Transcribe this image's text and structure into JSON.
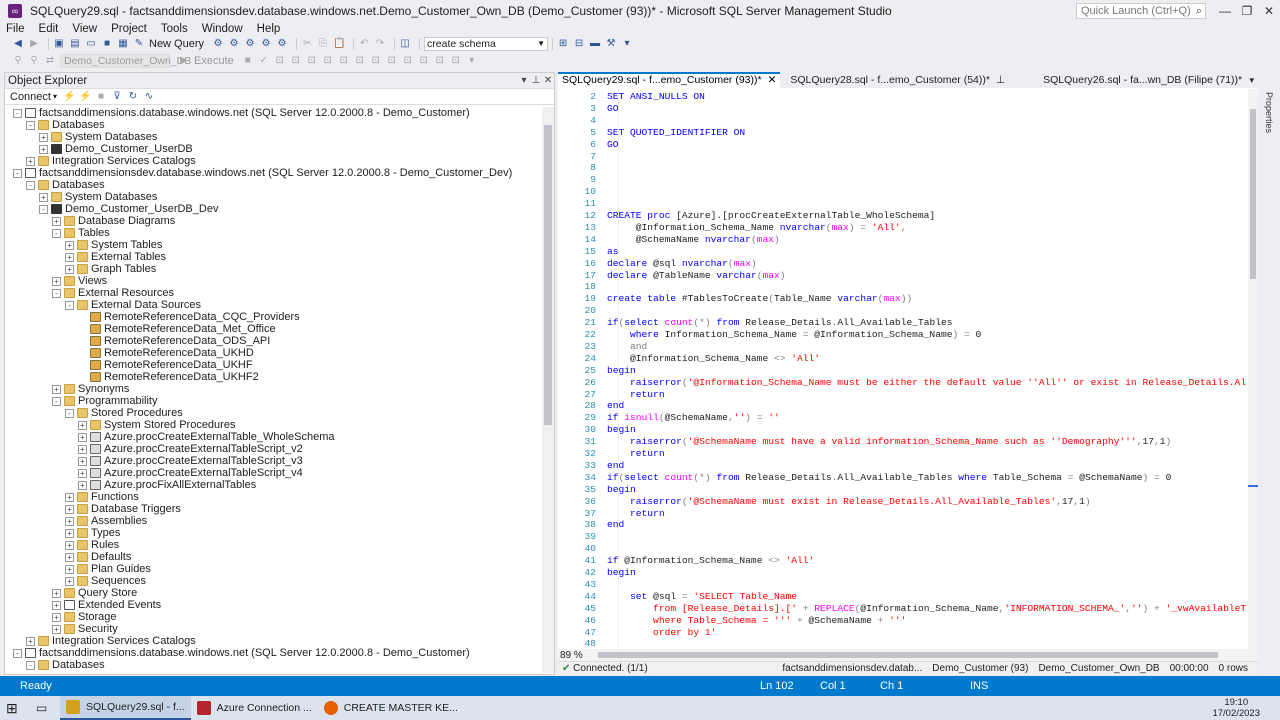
{
  "window": {
    "title": "SQLQuery29.sql - factsanddimensionsdev.database.windows.net.Demo_Customer_Own_DB (Demo_Customer (93))* - Microsoft SQL Server Management Studio",
    "quick_launch": "Quick Launch (Ctrl+Q)"
  },
  "menu": [
    "File",
    "Edit",
    "View",
    "Project",
    "Tools",
    "Window",
    "Help"
  ],
  "toolbar": {
    "new_query": "New Query",
    "search_value": "create schema",
    "database": "Demo_Customer_Own_DB",
    "execute": "Execute"
  },
  "object_explorer": {
    "title": "Object Explorer",
    "connect": "Connect",
    "tree": [
      {
        "d": 0,
        "e": "-",
        "i": "srv",
        "t": "factsanddimensions.database.windows.net (SQL Server 12.0.2000.8 - Demo_Customer)"
      },
      {
        "d": 1,
        "e": "-",
        "i": "fold",
        "t": "Databases"
      },
      {
        "d": 2,
        "e": "+",
        "i": "fold",
        "t": "System Databases"
      },
      {
        "d": 2,
        "e": "+",
        "i": "db",
        "t": "Demo_Customer_UserDB"
      },
      {
        "d": 1,
        "e": "+",
        "i": "fold",
        "t": "Integration Services Catalogs"
      },
      {
        "d": 0,
        "e": "-",
        "i": "srv",
        "t": "factsanddimensionsdev.database.windows.net (SQL Server 12.0.2000.8 - Demo_Customer_Dev)"
      },
      {
        "d": 1,
        "e": "-",
        "i": "fold",
        "t": "Databases"
      },
      {
        "d": 2,
        "e": "+",
        "i": "fold",
        "t": "System Databases"
      },
      {
        "d": 2,
        "e": "-",
        "i": "db",
        "t": "Demo_Customer_UserDB_Dev"
      },
      {
        "d": 3,
        "e": "+",
        "i": "fold",
        "t": "Database Diagrams"
      },
      {
        "d": 3,
        "e": "-",
        "i": "fold",
        "t": "Tables"
      },
      {
        "d": 4,
        "e": "+",
        "i": "fold",
        "t": "System Tables"
      },
      {
        "d": 4,
        "e": "+",
        "i": "fold",
        "t": "External Tables"
      },
      {
        "d": 4,
        "e": "+",
        "i": "fold",
        "t": "Graph Tables"
      },
      {
        "d": 3,
        "e": "+",
        "i": "fold",
        "t": "Views"
      },
      {
        "d": 3,
        "e": "-",
        "i": "fold",
        "t": "External Resources"
      },
      {
        "d": 4,
        "e": "-",
        "i": "fold",
        "t": "External Data Sources"
      },
      {
        "d": 5,
        "e": "",
        "i": "ext",
        "t": "RemoteReferenceData_CQC_Providers"
      },
      {
        "d": 5,
        "e": "",
        "i": "ext",
        "t": "RemoteReferenceData_Met_Office"
      },
      {
        "d": 5,
        "e": "",
        "i": "ext",
        "t": "RemoteReferenceData_ODS_API"
      },
      {
        "d": 5,
        "e": "",
        "i": "ext",
        "t": "RemoteReferenceData_UKHD"
      },
      {
        "d": 5,
        "e": "",
        "i": "ext",
        "t": "RemoteReferenceData_UKHF"
      },
      {
        "d": 5,
        "e": "",
        "i": "ext",
        "t": "RemoteReferenceData_UKHF2"
      },
      {
        "d": 3,
        "e": "+",
        "i": "fold",
        "t": "Synonyms"
      },
      {
        "d": 3,
        "e": "-",
        "i": "fold",
        "t": "Programmability"
      },
      {
        "d": 4,
        "e": "-",
        "i": "fold",
        "t": "Stored Procedures"
      },
      {
        "d": 5,
        "e": "+",
        "i": "fold",
        "t": "System Stored Procedures"
      },
      {
        "d": 5,
        "e": "+",
        "i": "proc",
        "t": "Azure.procCreateExternalTable_WholeSchema"
      },
      {
        "d": 5,
        "e": "+",
        "i": "proc",
        "t": "Azure.procCreateExternalTableScript_v2"
      },
      {
        "d": 5,
        "e": "+",
        "i": "proc",
        "t": "Azure.procCreateExternalTableScript_v3"
      },
      {
        "d": 5,
        "e": "+",
        "i": "proc",
        "t": "Azure.procCreateExternalTableScript_v4"
      },
      {
        "d": 5,
        "e": "+",
        "i": "proc",
        "t": "Azure.procFixAllExternalTables"
      },
      {
        "d": 4,
        "e": "+",
        "i": "fold",
        "t": "Functions"
      },
      {
        "d": 4,
        "e": "+",
        "i": "fold",
        "t": "Database Triggers"
      },
      {
        "d": 4,
        "e": "+",
        "i": "fold",
        "t": "Assemblies"
      },
      {
        "d": 4,
        "e": "+",
        "i": "fold",
        "t": "Types"
      },
      {
        "d": 4,
        "e": "+",
        "i": "fold",
        "t": "Rules"
      },
      {
        "d": 4,
        "e": "+",
        "i": "fold",
        "t": "Defaults"
      },
      {
        "d": 4,
        "e": "+",
        "i": "fold",
        "t": "Plan Guides"
      },
      {
        "d": 4,
        "e": "+",
        "i": "fold",
        "t": "Sequences"
      },
      {
        "d": 3,
        "e": "+",
        "i": "fold",
        "t": "Query Store"
      },
      {
        "d": 3,
        "e": "+",
        "i": "ev",
        "t": "Extended Events"
      },
      {
        "d": 3,
        "e": "+",
        "i": "fold",
        "t": "Storage"
      },
      {
        "d": 3,
        "e": "+",
        "i": "fold",
        "t": "Security"
      },
      {
        "d": 1,
        "e": "+",
        "i": "fold",
        "t": "Integration Services Catalogs"
      },
      {
        "d": 0,
        "e": "-",
        "i": "srv",
        "t": "factsanddimensions.database.windows.net (SQL Server 12.0.2000.8 - Demo_Customer)"
      },
      {
        "d": 1,
        "e": "-",
        "i": "fold",
        "t": "Databases"
      }
    ]
  },
  "tabs": [
    {
      "label": "SQLQuery29.sql - f...emo_Customer (93))*",
      "active": true,
      "close": "✕"
    },
    {
      "label": "SQLQuery28.sql - f...emo_Customer (54))*",
      "active": false,
      "close": ""
    },
    {
      "label": "SQLQuery26.sql - fa...wn_DB (Filipe (71))*",
      "active": false,
      "close": ""
    }
  ],
  "code": [
    {
      "n": "2",
      "h": "<span class='kw'>SET ANSI_NULLS ON</span>"
    },
    {
      "n": "3",
      "h": "<span class='kw'>GO</span>"
    },
    {
      "n": "4",
      "h": ""
    },
    {
      "n": "5",
      "h": "<span class='kw'>SET QUOTED_IDENTIFIER ON</span>"
    },
    {
      "n": "6",
      "h": "<span class='kw'>GO</span>"
    },
    {
      "n": "7",
      "h": ""
    },
    {
      "n": "8",
      "h": ""
    },
    {
      "n": "9",
      "h": ""
    },
    {
      "n": "10",
      "h": ""
    },
    {
      "n": "11",
      "h": ""
    },
    {
      "n": "12",
      "h": "<span class='kw'>CREATE proc</span> [Azure].[procCreateExternalTable_WholeSchema]"
    },
    {
      "n": "13",
      "h": "     @Information_Schema_Name <span class='ty'>nvarchar</span><span class='gr'>(</span><span class='fn'>max</span><span class='gr'>)</span> <span class='gr'>=</span> <span class='str'>'All'</span><span class='gr'>,</span>"
    },
    {
      "n": "14",
      "h": "     @SchemaName <span class='ty'>nvarchar</span><span class='gr'>(</span><span class='fn'>max</span><span class='gr'>)</span>"
    },
    {
      "n": "15",
      "h": "<span class='kw'>as</span>"
    },
    {
      "n": "16",
      "h": "<span class='kw'>declare</span> @sql <span class='ty'>nvarchar</span><span class='gr'>(</span><span class='fn'>max</span><span class='gr'>)</span>"
    },
    {
      "n": "17",
      "h": "<span class='kw'>declare</span> @TableName <span class='ty'>varchar</span><span class='gr'>(</span><span class='fn'>max</span><span class='gr'>)</span>"
    },
    {
      "n": "18",
      "h": ""
    },
    {
      "n": "19",
      "h": "<span class='kw'>create table</span> #TablesToCreate<span class='gr'>(</span>Table_Name <span class='ty'>varchar</span><span class='gr'>(</span><span class='fn'>max</span><span class='gr'>))</span>"
    },
    {
      "n": "20",
      "h": ""
    },
    {
      "n": "21",
      "h": "<span class='kw'>if</span><span class='gr'>(</span><span class='kw'>select</span> <span class='fn'>count</span><span class='gr'>(*)</span> <span class='kw'>from</span> Release_Details<span class='gr'>.</span>All_Available_Tables"
    },
    {
      "n": "22",
      "h": "    <span class='kw'>where</span> Information_Schema_Name <span class='gr'>=</span> @Information_Schema_Name<span class='gr'>)</span> <span class='gr'>=</span> 0"
    },
    {
      "n": "23",
      "h": "    <span class='gr'>and</span>"
    },
    {
      "n": "24",
      "h": "    @Information_Schema_Name <span class='gr'>&lt;&gt;</span> <span class='str'>'All'</span>"
    },
    {
      "n": "25",
      "h": "<span class='kw'>begin</span>"
    },
    {
      "n": "26",
      "h": "    <span class='kw'>raiserror</span><span class='gr'>(</span><span class='str'>'@Information_Schema_Name must be either the default value ''All'' or exist in Release_Details.All_Available_</span>"
    },
    {
      "n": "27",
      "h": "    <span class='kw'>return</span>"
    },
    {
      "n": "28",
      "h": "<span class='kw'>end</span>"
    },
    {
      "n": "29",
      "h": "<span class='kw'>if</span> <span class='fn'>isnull</span><span class='gr'>(</span>@SchemaName<span class='gr'>,</span><span class='str'>''</span><span class='gr'>)</span> <span class='gr'>=</span> <span class='str'>''</span>"
    },
    {
      "n": "30",
      "h": "<span class='kw'>begin</span>"
    },
    {
      "n": "31",
      "h": "    <span class='kw'>raiserror</span><span class='gr'>(</span><span class='str'>'@SchemaName must have a valid information_Schema_Name such as ''Demography'''</span><span class='gr'>,</span>17<span class='gr'>,</span>1<span class='gr'>)</span>"
    },
    {
      "n": "32",
      "h": "    <span class='kw'>return</span>"
    },
    {
      "n": "33",
      "h": "<span class='kw'>end</span>"
    },
    {
      "n": "34",
      "h": "<span class='kw'>if</span><span class='gr'>(</span><span class='kw'>select</span> <span class='fn'>count</span><span class='gr'>(*)</span> <span class='kw'>from</span> Release_Details<span class='gr'>.</span>All_Available_Tables <span class='kw'>where</span> Table_Schema <span class='gr'>=</span> @SchemaName<span class='gr'>)</span> <span class='gr'>=</span> 0"
    },
    {
      "n": "35",
      "h": "<span class='kw'>begin</span>"
    },
    {
      "n": "36",
      "h": "    <span class='kw'>raiserror</span><span class='gr'>(</span><span class='str'>'@SchemaName must exist in Release_Details.All_Available_Tables'</span><span class='gr'>,</span>17<span class='gr'>,</span>1<span class='gr'>)</span>"
    },
    {
      "n": "37",
      "h": "    <span class='kw'>return</span>"
    },
    {
      "n": "38",
      "h": "<span class='kw'>end</span>"
    },
    {
      "n": "39",
      "h": ""
    },
    {
      "n": "40",
      "h": ""
    },
    {
      "n": "41",
      "h": "<span class='kw'>if</span> @Information_Schema_Name <span class='gr'>&lt;&gt;</span> <span class='str'>'All'</span>"
    },
    {
      "n": "42",
      "h": "<span class='kw'>begin</span>"
    },
    {
      "n": "43",
      "h": ""
    },
    {
      "n": "44",
      "h": "    <span class='kw'>set</span> @sql <span class='gr'>=</span> <span class='str'>'SELECT Table_Name</span>"
    },
    {
      "n": "45",
      "h": "<span class='str'>        from [Release_Details].['</span> <span class='gr'>+</span> <span class='fn'>REPLACE</span><span class='gr'>(</span>@Information_Schema_Name<span class='gr'>,</span><span class='str'>'INFORMATION_SCHEMA_'</span><span class='gr'>,</span><span class='str'>''</span><span class='gr'>)</span> <span class='gr'>+</span> <span class='str'>'_vwAvailableTables]</span>"
    },
    {
      "n": "46",
      "h": "<span class='str'>        where Table_Schema = '''</span> <span class='gr'>+</span> @SchemaName <span class='gr'>+</span> <span class='str'>'''</span>"
    },
    {
      "n": "47",
      "h": "<span class='str'>        order by 1'</span>"
    },
    {
      "n": "48",
      "h": ""
    }
  ],
  "editor_status": {
    "zoom": "89 %",
    "connected": "Connected. (1/1)",
    "server": "factsanddimensionsdev.datab...",
    "user": "Demo_Customer (93)",
    "database": "Demo_Customer_Own_DB",
    "time": "00:00:00",
    "rows": "0 rows"
  },
  "right_panel": "Properties",
  "status_bar": {
    "ready": "Ready",
    "ln": "Ln 102",
    "col": "Col 1",
    "ch": "Ch 1",
    "mode": "INS"
  },
  "taskbar": {
    "items": [
      {
        "label": "SQLQuery29.sql - f...",
        "color": "#d4a017"
      },
      {
        "label": "Azure Connection ...",
        "color": "#b4262b"
      },
      {
        "label": "CREATE MASTER KE...",
        "color": "#e66000"
      }
    ],
    "time": "19:10",
    "date": "17/02/2023"
  }
}
